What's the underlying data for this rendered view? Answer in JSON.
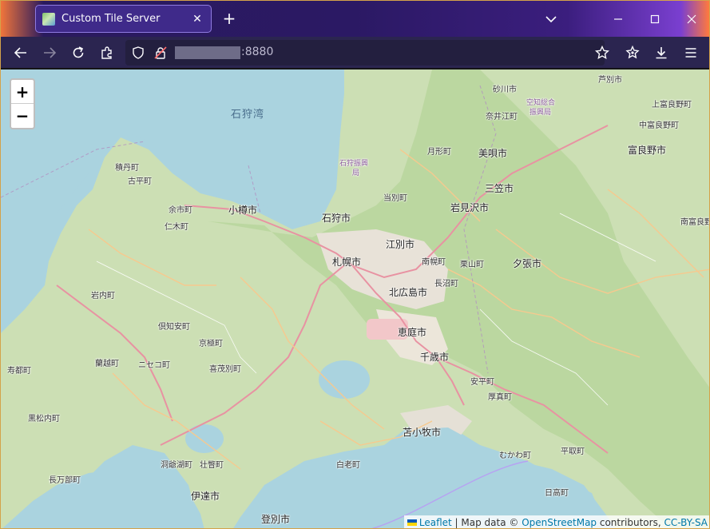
{
  "browser": {
    "tab_title": "Custom Tile Server",
    "url_port": ":8880"
  },
  "map": {
    "zoom_in": "+",
    "zoom_out": "−",
    "attribution": {
      "leaflet": "Leaflet",
      "sep1": " | Map data © ",
      "osm": "OpenStreetMap",
      "sep2": " contributors, ",
      "license": "CC-BY-SA"
    },
    "labels": {
      "sea": "石狩湾",
      "sunagawa": "砂川市",
      "ashibetsu": "芦別市",
      "sorachi_office": "空知総合",
      "sorachi_office2": "振興局",
      "kamifurano": "上富良野町",
      "nakafurano": "中富良野町",
      "furano": "富良野市",
      "naie": "奈井江町",
      "tsukigata": "月形町",
      "bibai": "美唄市",
      "ishikari_office": "石狩振興",
      "ishikari_office2": "局",
      "shakotan": "積丹町",
      "furubira": "古平町",
      "toma": "当別町",
      "mikasa": "三笠市",
      "yoichi": "余市町",
      "otaru": "小樽市",
      "ishikari": "石狩市",
      "iwamizawa": "岩見沢市",
      "niki": "仁木町",
      "minamifurano": "南富良野",
      "ebetsu": "江別市",
      "sapporo": "札幌市",
      "nanporo": "南幌町",
      "kuriyama": "栗山町",
      "yubari": "夕張市",
      "naganuma": "長沼町",
      "kitahiroshima": "北広島市",
      "iwanai": "岩内町",
      "kutchan": "倶知安町",
      "eniwa": "恵庭市",
      "kyogoku": "京極町",
      "chitose": "千歳市",
      "suttsu": "寿都町",
      "rankoshi": "蘭越町",
      "niseko": "ニセコ町",
      "kimobetsu": "喜茂別町",
      "abira": "安平町",
      "atsuma": "厚真町",
      "kuromatsunai": "黒松内町",
      "tomakomai": "苫小牧市",
      "hiratori": "平取町",
      "toyako": "洞爺湖町",
      "sobetsu": "壮瞥町",
      "shiraoi": "白老町",
      "mukawa": "むかわ町",
      "oshamambe": "長万部町",
      "date": "伊達市",
      "hidaka": "日高町",
      "noboribetsu": "登別市"
    }
  }
}
